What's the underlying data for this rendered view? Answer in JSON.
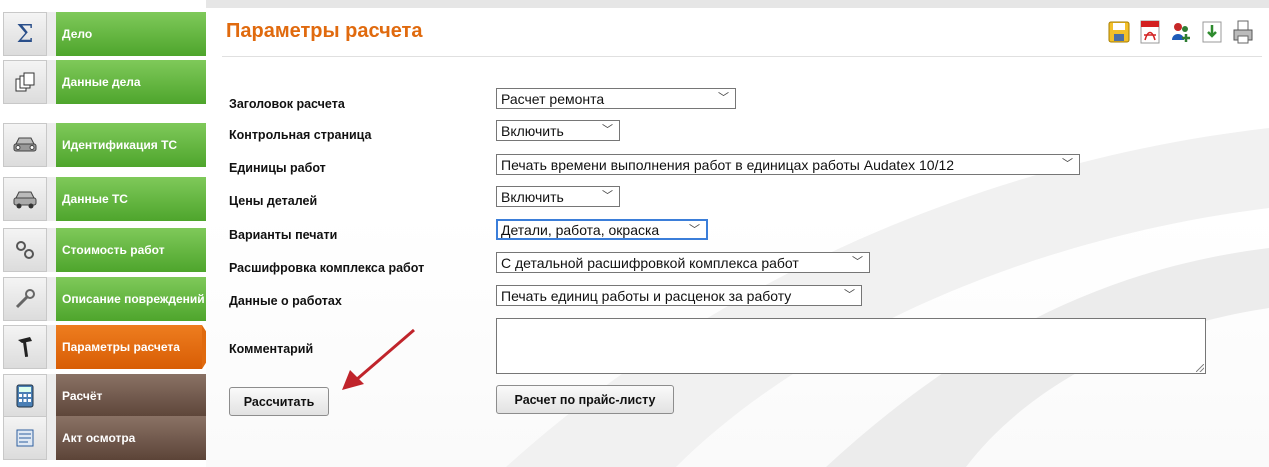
{
  "colors": {
    "accent": "#e06a0e",
    "nav_green": "#5aad35",
    "nav_brown": "#6b5347",
    "nav_active": "#e06a0e"
  },
  "sidebar": {
    "items": [
      {
        "label": "Дело",
        "icon": "sigma-icon"
      },
      {
        "label": "Данные дела",
        "icon": "documents-icon"
      },
      {
        "label": "Идентификация ТС",
        "icon": "car-front-icon"
      },
      {
        "label": "Данные ТС",
        "icon": "car-icon"
      },
      {
        "label": "Стоимость работ",
        "icon": "gears-icon"
      },
      {
        "label": "Описание повреждений",
        "icon": "wrench-icon"
      },
      {
        "label": "Параметры расчета",
        "icon": "hammer-icon"
      },
      {
        "label": "Расчёт",
        "icon": "calculator-icon"
      },
      {
        "label": "Акт осмотра",
        "icon": "report-icon"
      }
    ]
  },
  "header": {
    "title": "Параметры расчета"
  },
  "toolbar": {
    "icons": [
      "save-icon",
      "pdf-icon",
      "add-users-icon",
      "import-icon",
      "print-icon"
    ]
  },
  "form": {
    "rows": [
      {
        "label": "Заголовок расчета",
        "value": "Расчет ремонта"
      },
      {
        "label": "Контрольная страница",
        "value": "Включить"
      },
      {
        "label": "Единицы работ",
        "value": "Печать времени выполнения работ в единицах работы Audatex 10/12"
      },
      {
        "label": "Цены деталей",
        "value": "Включить"
      },
      {
        "label": "Варианты печати",
        "value": "Детали, работа, окраска"
      },
      {
        "label": "Расшифровка комплекса работ",
        "value": "С детальной расшифровкой комплекса работ"
      },
      {
        "label": "Данные о работах",
        "value": "Печать единиц работы и расценок за работу"
      }
    ],
    "comment_label": "Комментарий",
    "comment_value": ""
  },
  "buttons": {
    "calculate": "Рассчитать",
    "price_list": "Расчет по прайс-листу"
  }
}
